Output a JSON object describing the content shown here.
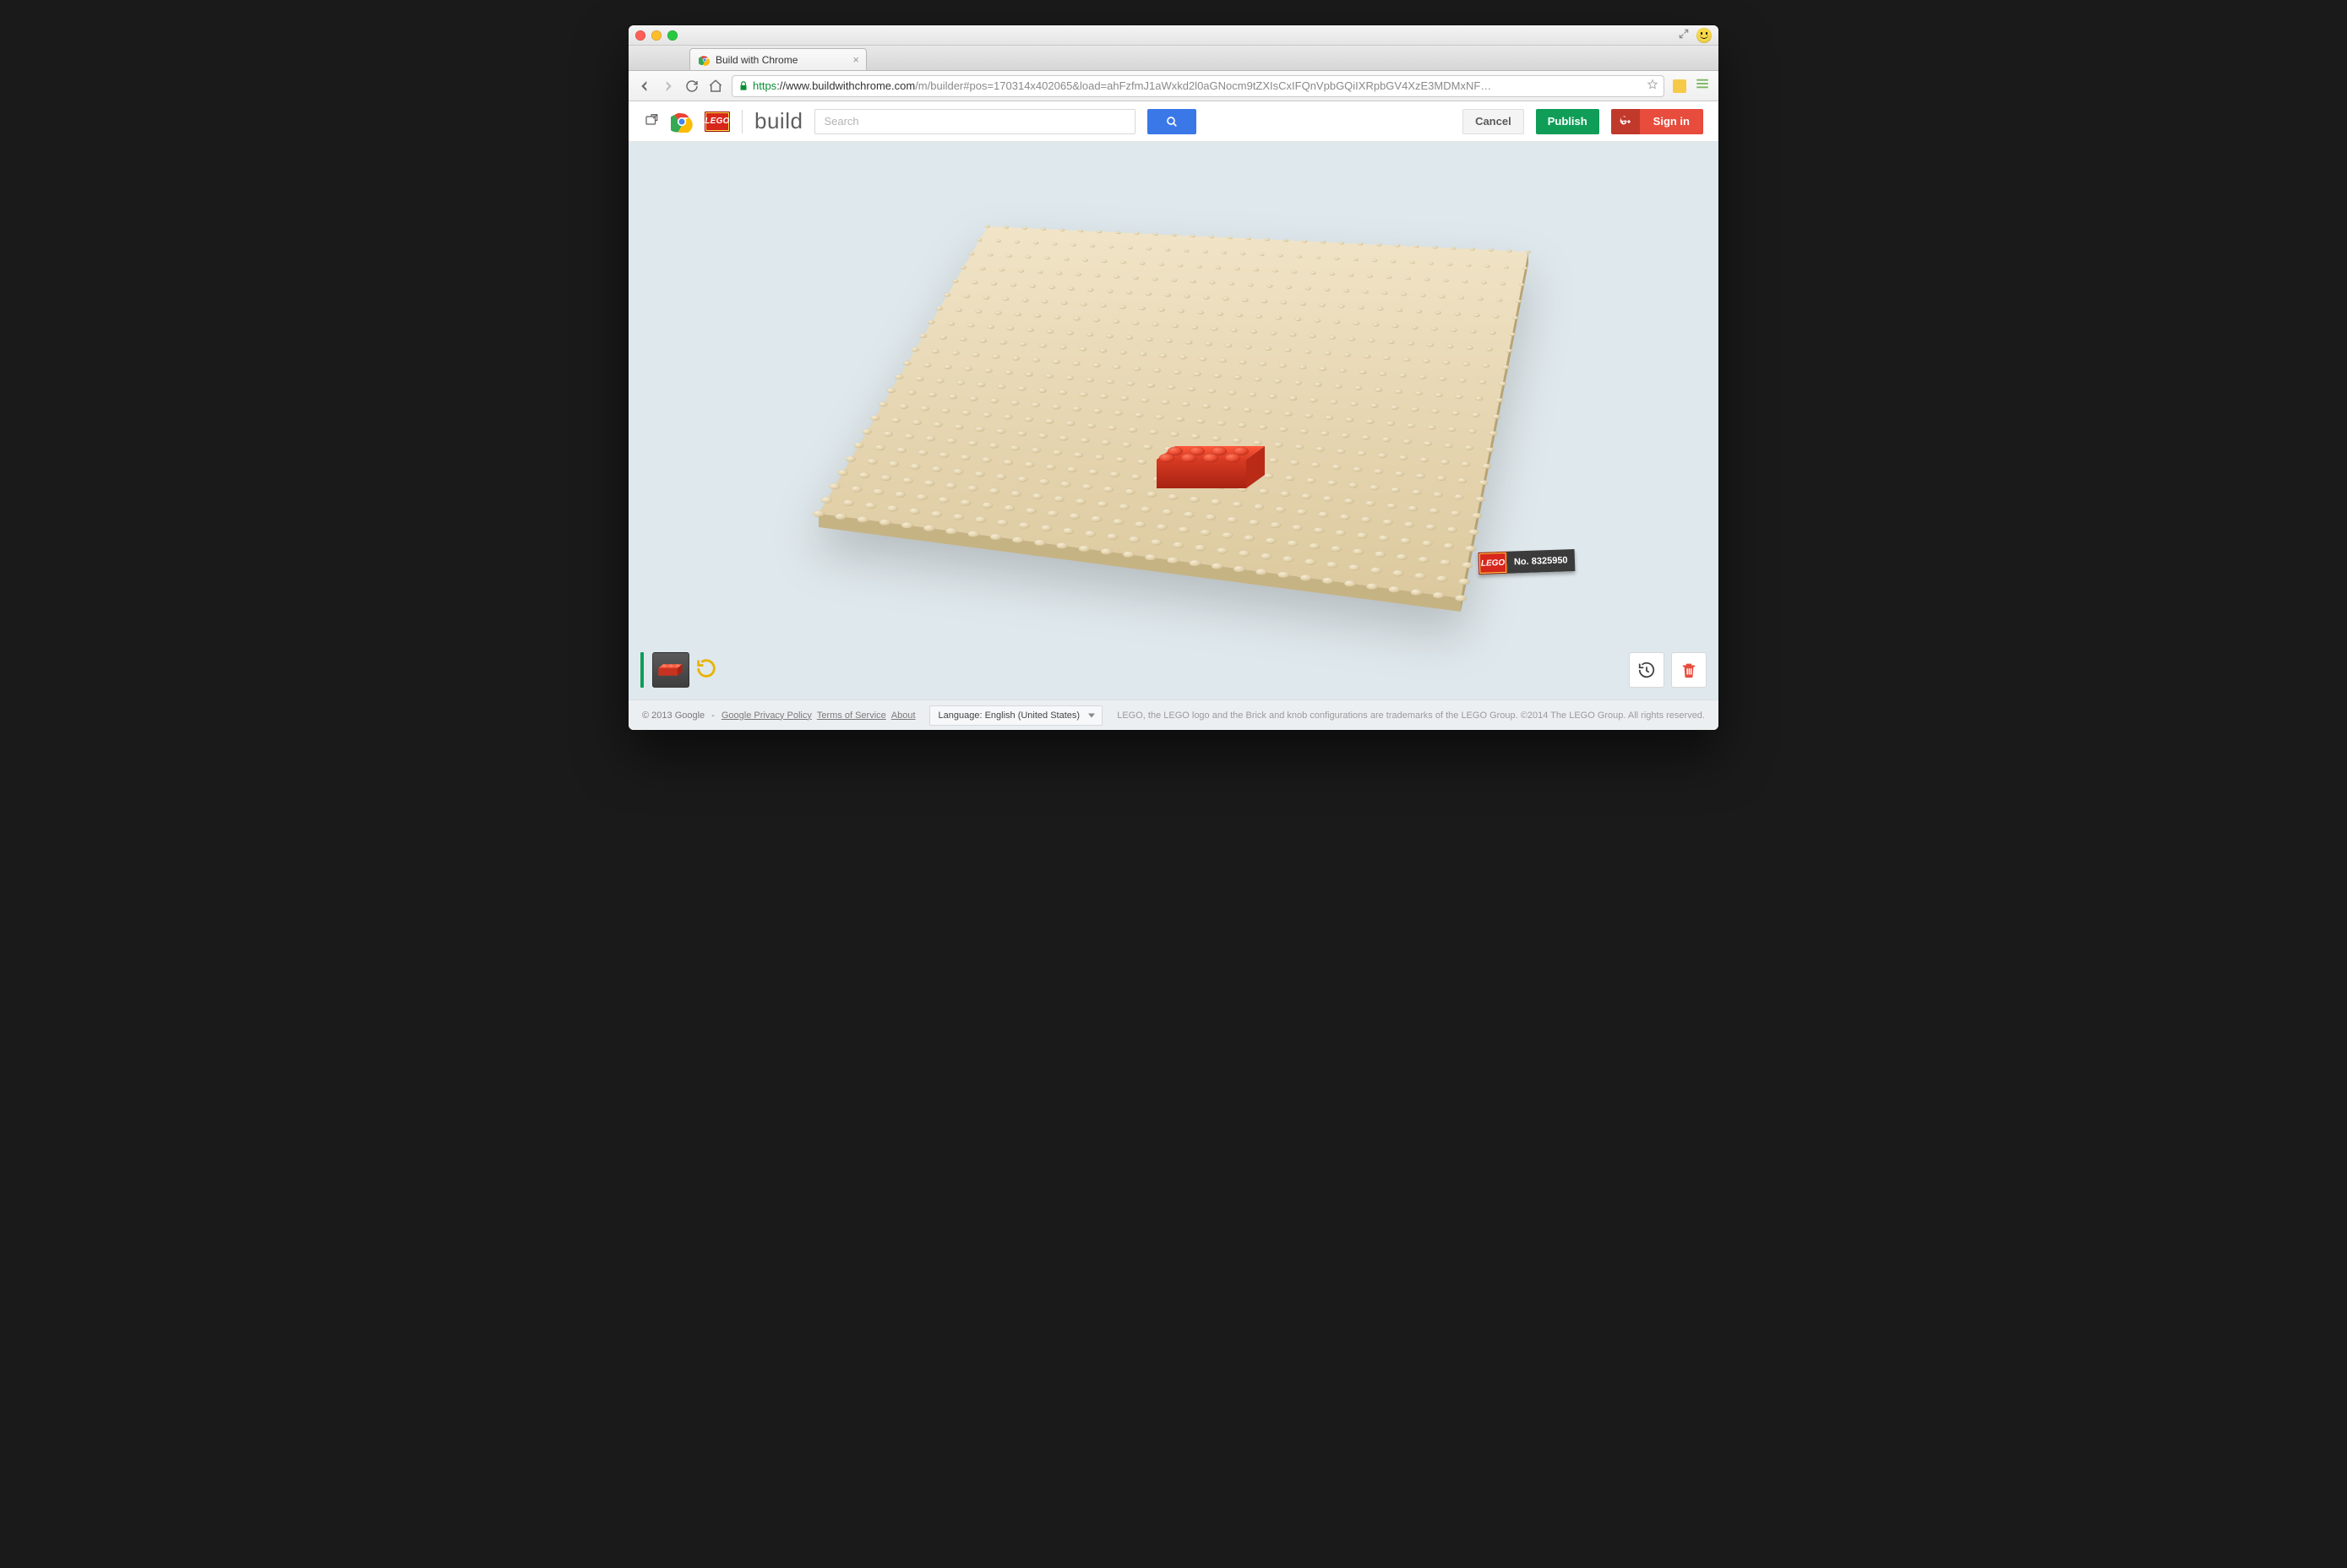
{
  "browser": {
    "tab_title": "Build with Chrome",
    "url_scheme": "https",
    "url_host": "://www.buildwithchrome.com",
    "url_path": "/m/builder#pos=170314x402065&load=ahFzfmJ1aWxkd2l0aGNocm9tZXIsCxIFQnVpbGQiIXRpbGV4XzE3MDMxNF…"
  },
  "header": {
    "lego_text": "LEGO",
    "brand_word": "build",
    "search_placeholder": "Search",
    "cancel": "Cancel",
    "publish": "Publish",
    "sign_in": "Sign in"
  },
  "set": {
    "lego_text": "LEGO",
    "number_label": "No. 8325950"
  },
  "footer": {
    "copyright": "© 2013 Google",
    "privacy": "Google Privacy Policy",
    "terms": "Terms of Service",
    "about": "About",
    "language_label": "Language: English (United States)",
    "legal": "LEGO, the LEGO logo and the Brick and knob configurations are trademarks of the LEGO Group. ©2014 The LEGO Group. All rights reserved."
  },
  "colors": {
    "brick_red": "#e53522",
    "baseplate": "#e9d9b5",
    "publish_green": "#0f9d58",
    "signin_red": "#e74c3c",
    "search_blue": "#3b78e7"
  }
}
